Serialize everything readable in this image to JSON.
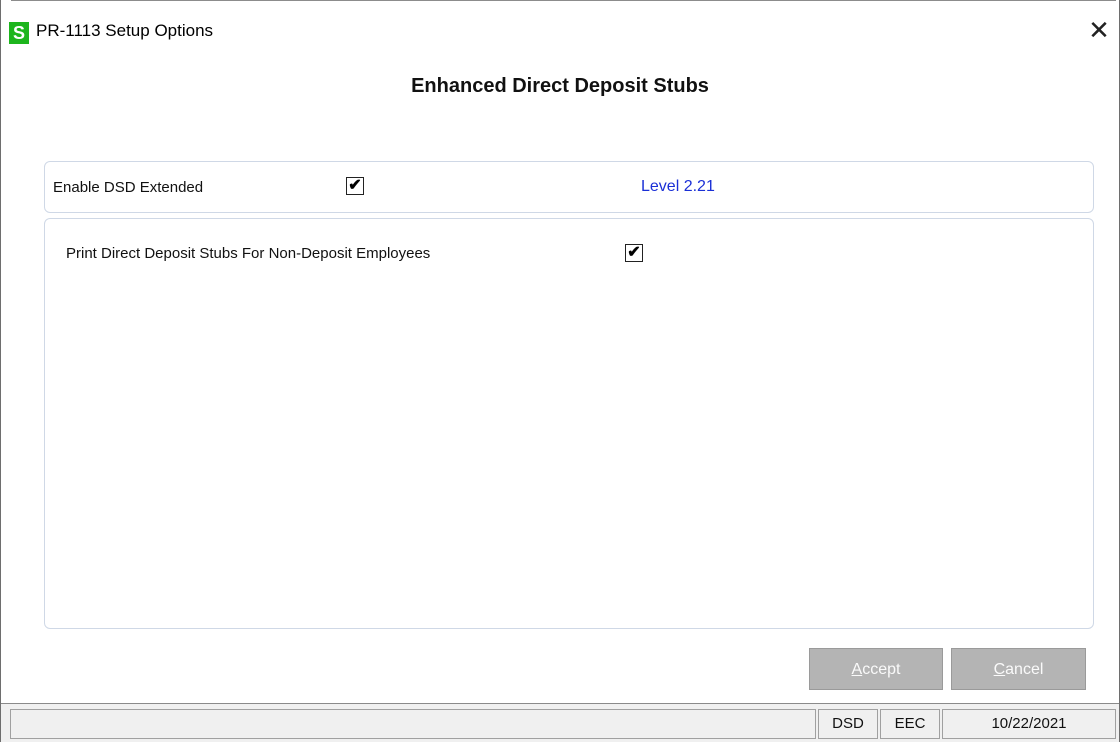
{
  "window": {
    "title": "PR-1113 Setup Options",
    "app_icon_letter": "S",
    "close_glyph": "✕"
  },
  "header": {
    "title": "Enhanced Direct Deposit Stubs"
  },
  "options": {
    "enable_dsd_label": "Enable DSD Extended",
    "enable_dsd_checked": true,
    "level_text": "Level  2.21",
    "print_stubs_label": "Print Direct Deposit Stubs For Non-Deposit Employees",
    "print_stubs_checked": true,
    "check_glyph": "✔"
  },
  "buttons": {
    "accept_mnemonic": "A",
    "accept_rest": "ccept",
    "cancel_mnemonic": "C",
    "cancel_rest": "ancel"
  },
  "statusbar": {
    "message": "",
    "cell1": "DSD",
    "cell2": "EEC",
    "date": "10/22/2021"
  },
  "colors": {
    "accent_icon": "#1db51d",
    "level_text": "#1a2fd6",
    "button_disabled_bg": "#b4b4b4"
  }
}
